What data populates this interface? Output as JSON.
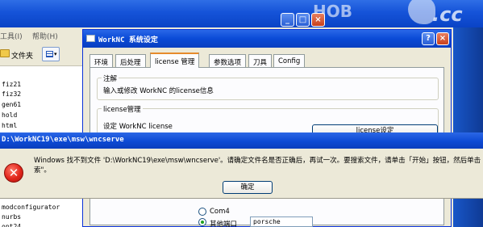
{
  "background_window": {
    "menu": [
      "工具(I)",
      "帮助(H)"
    ],
    "toolbar": {
      "folders_label": "文件夹"
    },
    "files": [
      "fiz21",
      "fiz32",
      "gen61",
      "hold",
      "html",
      "modconfigurator",
      "nurbs",
      "opt24"
    ],
    "logo_text": "HOB",
    "logo_cc": ".cc",
    "minimize": "_",
    "maximize": "□",
    "close": "×"
  },
  "worknc_window": {
    "title": "WorkNC 系统设定",
    "help": "?",
    "close": "×",
    "tabs": [
      "环境",
      "后处理",
      "license 管理",
      "参数选项",
      "刀具",
      "Config"
    ],
    "active_tab": "license 管理",
    "note_group": {
      "label": "注解",
      "text": "输入或修改 WorkNC 的license信息"
    },
    "license_group": {
      "label": "license管理",
      "text": "设定 WorkNC license",
      "button": "license设定"
    },
    "port": {
      "com_label": "Com4",
      "other_label": "其他端口",
      "value": "porsche"
    }
  },
  "error_dialog": {
    "title": "D:\\WorkNC19\\exe\\msw\\wncserve",
    "message_line1": "Windows 找不到文件 'D:\\WorkNC19\\exe\\msw\\wncserve'。请确定文件名是否正确后，再试一次。要搜索文件，请单击「开始」按钮，然后单击 \"",
    "message_line2": "索\"。",
    "ok_button": "确定"
  }
}
